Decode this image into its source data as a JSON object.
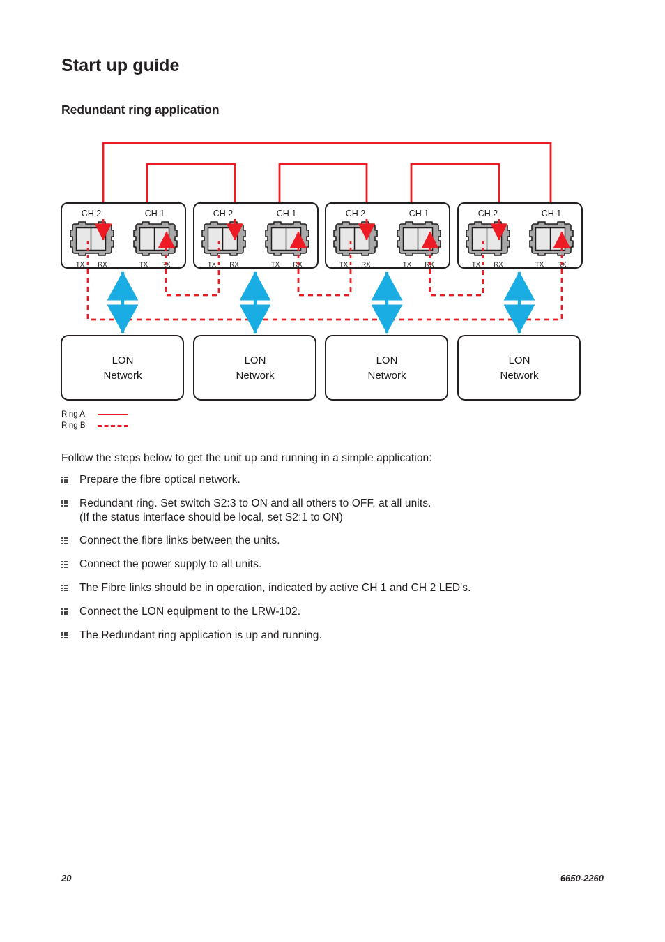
{
  "document": {
    "page_title": "Start up guide",
    "section_title": "Redundant ring application"
  },
  "diagram": {
    "modules": [
      {
        "ch2_label": "CH 2",
        "ch1_label": "CH 1",
        "tx_label": "TX",
        "rx_label": "RX"
      },
      {
        "ch2_label": "CH 2",
        "ch1_label": "CH 1",
        "tx_label": "TX",
        "rx_label": "RX"
      },
      {
        "ch2_label": "CH 2",
        "ch1_label": "CH 1",
        "tx_label": "TX",
        "rx_label": "RX"
      },
      {
        "ch2_label": "CH 2",
        "ch1_label": "CH 1",
        "tx_label": "TX",
        "rx_label": "RX"
      }
    ],
    "networks": [
      {
        "line1": "LON",
        "line2": "Network"
      },
      {
        "line1": "LON",
        "line2": "Network"
      },
      {
        "line1": "LON",
        "line2": "Network"
      },
      {
        "line1": "LON",
        "line2": "Network"
      }
    ],
    "colors": {
      "ring": "#ED1C24",
      "link": "#19ADE4",
      "connector_body": "#A8A8A8",
      "connector_inner": "#E8E8E8",
      "outline": "#231f20"
    }
  },
  "legend": {
    "rows": [
      {
        "label": "Ring A",
        "style": "solid"
      },
      {
        "label": "Ring B",
        "style": "dashed"
      }
    ]
  },
  "instructions": {
    "intro": "Follow the steps below to get the unit up and running in a simple application:",
    "steps": [
      {
        "text": "Prepare the fibre optical network.",
        "sub": ""
      },
      {
        "text": "Redundant ring. Set switch S2:3 to ON and all others to OFF, at all units.",
        "sub": "(If the status interface should be local, set S2:1 to ON)"
      },
      {
        "text": "Connect the fibre links between the units.",
        "sub": ""
      },
      {
        "text": "Connect the power supply to all units.",
        "sub": ""
      },
      {
        "text": "The Fibre links should be in operation, indicated by active CH 1 and CH 2 LED's.",
        "sub": ""
      },
      {
        "text": "Connect the LON equipment to the LRW-102.",
        "sub": ""
      },
      {
        "text": "The Redundant ring application is up and running.",
        "sub": ""
      }
    ]
  },
  "footer": {
    "page_number": "20",
    "document_number": "6650-2260"
  }
}
